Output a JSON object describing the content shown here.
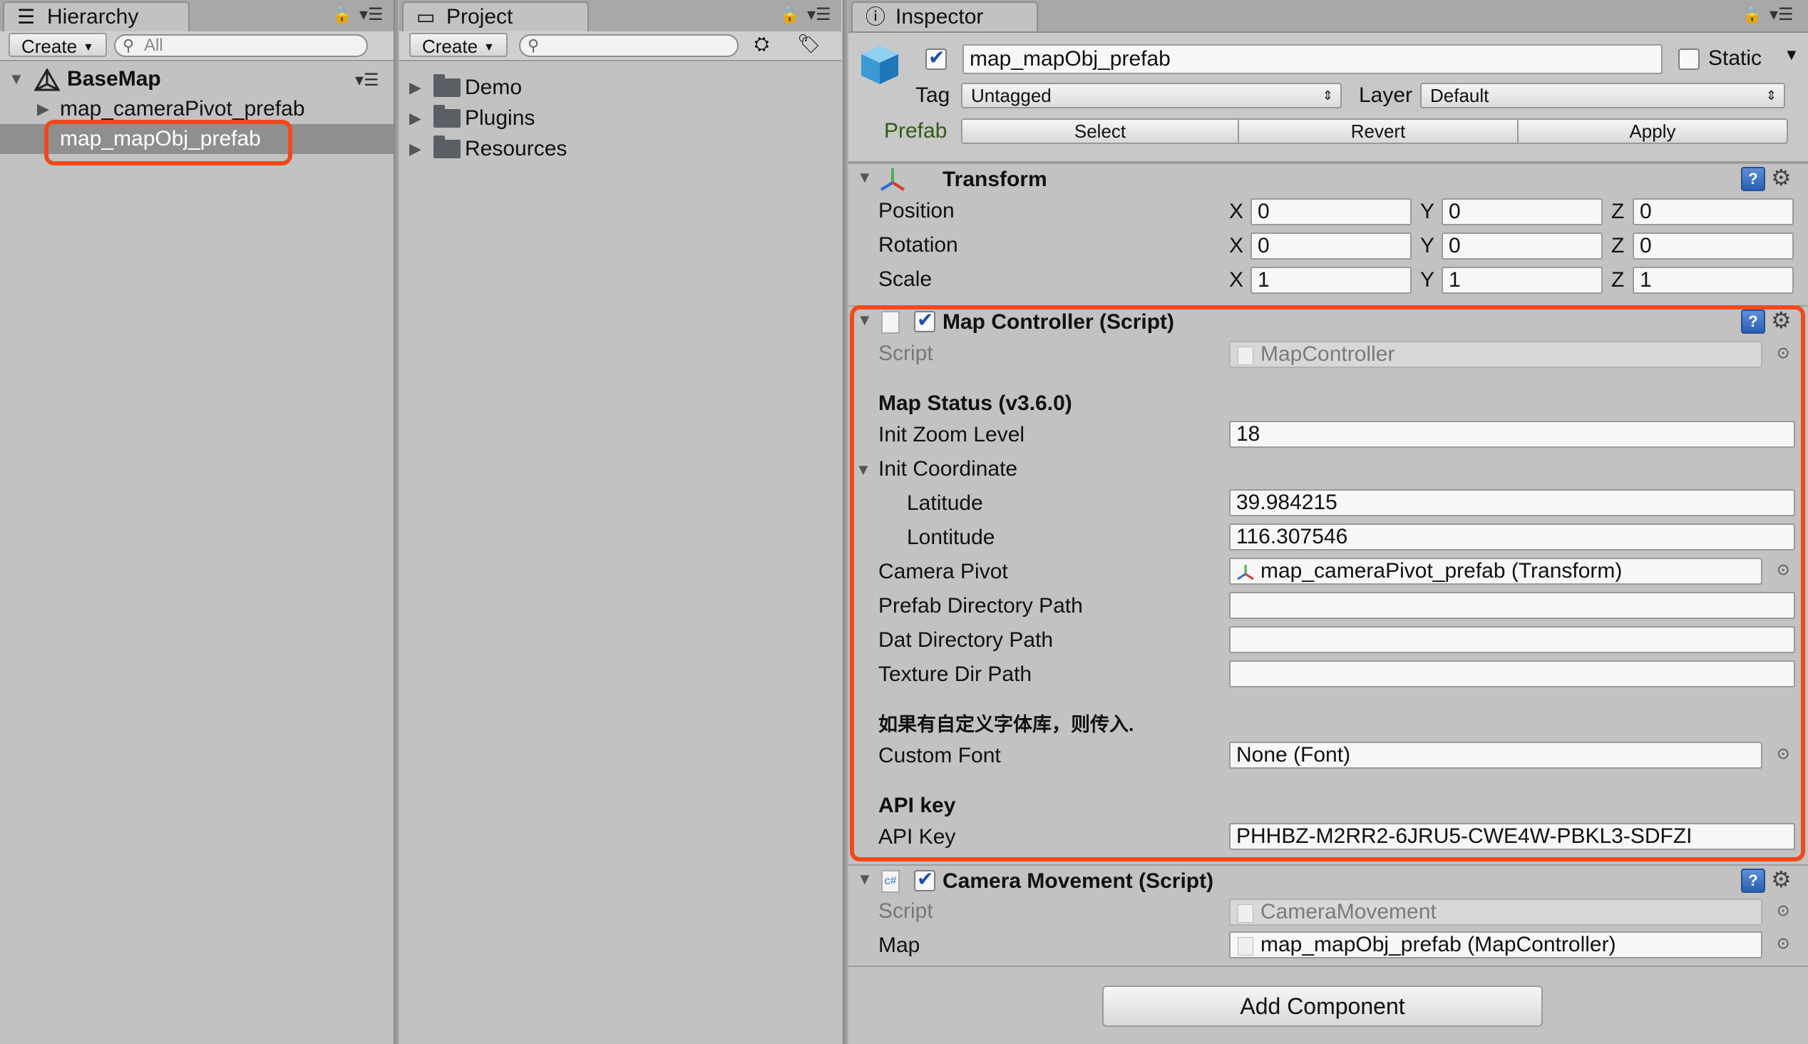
{
  "hierarchy": {
    "tab_label": "Hierarchy",
    "create_label": "Create",
    "search_placeholder": "All",
    "scene_name": "BaseMap",
    "items": [
      {
        "label": "map_cameraPivot_prefab"
      },
      {
        "label": "map_mapObj_prefab",
        "selected": true
      }
    ]
  },
  "project": {
    "tab_label": "Project",
    "create_label": "Create",
    "folders": [
      {
        "label": "Demo"
      },
      {
        "label": "Plugins"
      },
      {
        "label": "Resources"
      }
    ]
  },
  "inspector": {
    "tab_label": "Inspector",
    "object_name": "map_mapObj_prefab",
    "active": true,
    "static_label": "Static",
    "static_checked": false,
    "tag_label": "Tag",
    "tag_value": "Untagged",
    "layer_label": "Layer",
    "layer_value": "Default",
    "prefab_label": "Prefab",
    "prefab_buttons": {
      "select": "Select",
      "revert": "Revert",
      "apply": "Apply"
    },
    "transform": {
      "title": "Transform",
      "rows": [
        {
          "label": "Position",
          "x": "0",
          "y": "0",
          "z": "0"
        },
        {
          "label": "Rotation",
          "x": "0",
          "y": "0",
          "z": "0"
        },
        {
          "label": "Scale",
          "x": "1",
          "y": "1",
          "z": "1"
        }
      ],
      "axis": {
        "x": "X",
        "y": "Y",
        "z": "Z"
      }
    },
    "map_controller": {
      "title": "Map Controller (Script)",
      "script_label": "Script",
      "script_value": "MapController",
      "status_heading": "Map Status (v3.6.0)",
      "zoom_label": "Init Zoom Level",
      "zoom_value": "18",
      "coord_label": "Init Coordinate",
      "lat_label": "Latitude",
      "lat_value": "39.984215",
      "lon_label": "Lontitude",
      "lon_value": "116.307546",
      "camera_pivot_label": "Camera Pivot",
      "camera_pivot_value": "map_cameraPivot_prefab (Transform)",
      "prefab_dir_label": "Prefab Directory Path",
      "prefab_dir_value": "",
      "dat_dir_label": "Dat Directory Path",
      "dat_dir_value": "",
      "texture_dir_label": "Texture Dir Path",
      "texture_dir_value": "",
      "font_note": "如果有自定义字体库，则传入.",
      "custom_font_label": "Custom Font",
      "custom_font_value": "None (Font)",
      "api_heading": "API key",
      "api_label": "API Key",
      "api_value": "PHHBZ-M2RR2-6JRU5-CWE4W-PBKL3-SDFZI"
    },
    "camera_movement": {
      "title": "Camera Movement (Script)",
      "script_label": "Script",
      "script_value": "CameraMovement",
      "map_label": "Map",
      "map_value": "map_mapObj_prefab (MapController)"
    },
    "add_component_label": "Add Component"
  },
  "highlight_color": "#f04a1c"
}
